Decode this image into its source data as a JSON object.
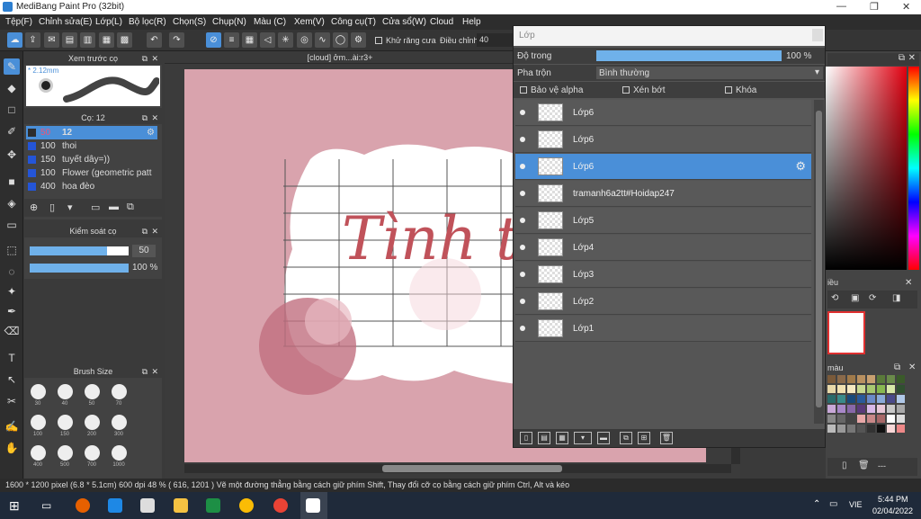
{
  "window": {
    "title": "MediBang Paint Pro (32bit)"
  },
  "menu": [
    "Tệp(F)",
    "Chỉnh sửa(E)",
    "Lớp(L)",
    "Bộ lọc(R)",
    "Chọn(S)",
    "Chụp(N)",
    "Màu (C)",
    "Xem(V)",
    "Công cụ(T)",
    "Cửa sổ(W)",
    "Cloud",
    "Help"
  ],
  "toolbar": {
    "antialias_label": "Khử răng cưa",
    "adjust_label": "Điều chỉnh",
    "adjust_value": "40"
  },
  "preview": {
    "title": "Xem trước cọ",
    "size": "2.12mm"
  },
  "brushes": {
    "title": "Cọ: 12",
    "items": [
      {
        "size": "50",
        "name": "12"
      },
      {
        "size": "100",
        "name": "thoi"
      },
      {
        "size": "150",
        "name": "tuyết dây=))"
      },
      {
        "size": "100",
        "name": "Flower (geometric patt"
      },
      {
        "size": "400",
        "name": "hoa đèo"
      }
    ]
  },
  "brush_control": {
    "title": "Kiểm soát cọ",
    "size_value": "50",
    "opacity_value": "100 %",
    "opacity_fraction": 1.0,
    "size_fraction": 0.78
  },
  "brush_size": {
    "title": "Brush Size",
    "sizes": [
      "30",
      "40",
      "50",
      "70",
      "100",
      "150",
      "200",
      "300",
      "400",
      "500",
      "700",
      "1000"
    ]
  },
  "document": {
    "tab": "[cloud] ởm...ài:r3+",
    "canvas_text": "Tình ta"
  },
  "layer_panel": {
    "title": "Lớp",
    "opacity_label": "Độ trong",
    "opacity_value": "100 %",
    "opacity_fraction": 1.0,
    "blend_label": "Pha trộn",
    "blend_value": "Bình thường",
    "protect_alpha": "Bảo vệ alpha",
    "clipping": "Xén bớt",
    "lock": "Khóa",
    "layers": [
      {
        "name": "Lớp6",
        "selected": false
      },
      {
        "name": "Lớp6",
        "selected": false
      },
      {
        "name": "Lớp6",
        "selected": true
      },
      {
        "name": "tramanh6a2tt#Hoidap247",
        "selected": false
      },
      {
        "name": "Lớp5",
        "selected": false
      },
      {
        "name": "Lớp4",
        "selected": false
      },
      {
        "name": "Lớp3",
        "selected": false
      },
      {
        "name": "Lớp2",
        "selected": false
      },
      {
        "name": "Lớp1",
        "selected": false
      }
    ]
  },
  "right": {
    "nav_label": "iều",
    "palette_label": "màu",
    "footer": "---"
  },
  "status": {
    "text": "1600 * 1200 pixel   (6.8 * 5.1cm)   600 dpi   48 %   ( 616, 1201 )   Vẽ một đường thẳng bằng cách giữ phím Shift, Thay đổi cỡ cọ bằng cách giữ phím Ctrl, Alt và kéo"
  },
  "taskbar": {
    "lang": "VIE",
    "time": "5:44 PM",
    "date": "02/04/2022"
  },
  "colors": {
    "accent": "#4a8fd8",
    "paper": "#d9a3ad",
    "text_red": "#c0525a"
  }
}
